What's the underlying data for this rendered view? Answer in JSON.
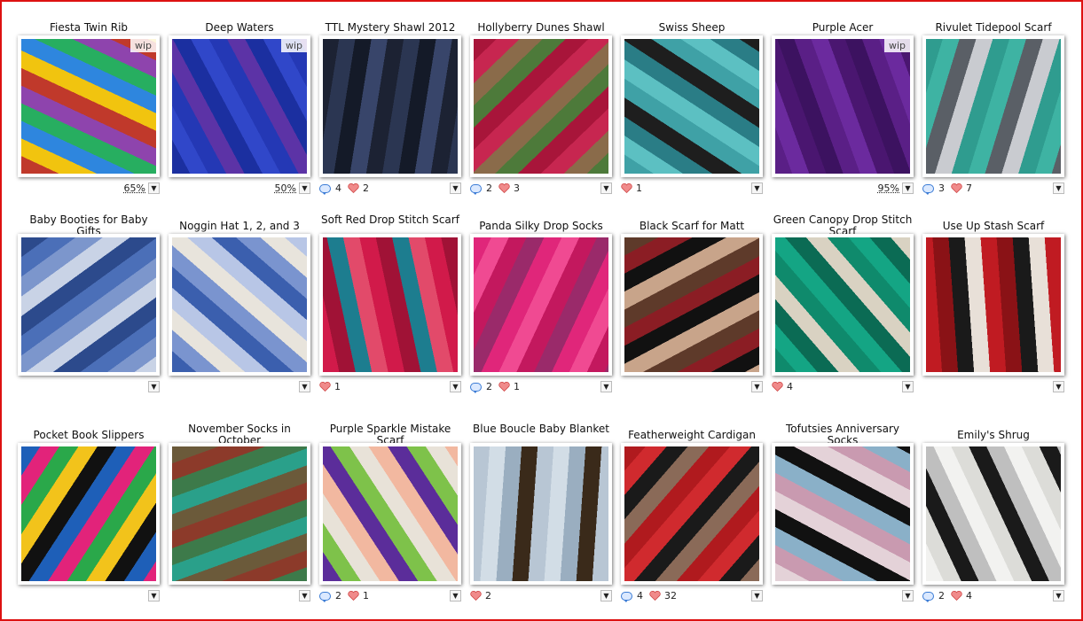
{
  "projects": [
    {
      "title": "Fiesta Twin Rib",
      "wip": "wip",
      "progress": "65%",
      "comments": "",
      "favorites": "",
      "colors": [
        "#c0392b",
        "#f1c40f",
        "#2e86de",
        "#27ae60",
        "#8e44ad"
      ]
    },
    {
      "title": "Deep Waters",
      "wip": "wip",
      "progress": "50%",
      "comments": "",
      "favorites": "",
      "colors": [
        "#1b2fa0",
        "#3047c9",
        "#2438b5",
        "#5c33a6"
      ]
    },
    {
      "title": "TTL Mystery Shawl 2012",
      "wip": "",
      "progress": "",
      "comments": "4",
      "favorites": "2",
      "colors": [
        "#1c2233",
        "#2b3652",
        "#141a28",
        "#38456a"
      ]
    },
    {
      "title": "Hollyberry Dunes Shawl",
      "wip": "",
      "progress": "",
      "comments": "2",
      "favorites": "3",
      "colors": [
        "#a8153a",
        "#c72650",
        "#8a6b4a",
        "#4d7a3a"
      ]
    },
    {
      "title": "Swiss Sheep",
      "wip": "",
      "progress": "",
      "comments": "",
      "favorites": "1",
      "colors": [
        "#3fa1a6",
        "#5cc0c2",
        "#2a7d86",
        "#1e1e1e"
      ]
    },
    {
      "title": "Purple Acer",
      "wip": "wip",
      "progress": "95%",
      "comments": "",
      "favorites": "",
      "colors": [
        "#5a1f86",
        "#6b2a9e",
        "#4a1670",
        "#3c1260"
      ]
    },
    {
      "title": "Rivulet Tidepool Scarf",
      "wip": "",
      "progress": "",
      "comments": "3",
      "favorites": "7",
      "colors": [
        "#2f9c8f",
        "#3eb3a3",
        "#5a5f66",
        "#c9cbd0"
      ]
    },
    {
      "title": "Baby Booties for Baby Gifts",
      "wip": "",
      "progress": "",
      "comments": "",
      "favorites": "",
      "colors": [
        "#2c4a8c",
        "#4b6fb8",
        "#7c96cc",
        "#c9d3e6"
      ]
    },
    {
      "title": "Noggin Hat 1, 2, and 3",
      "wip": "",
      "progress": "",
      "comments": "",
      "favorites": "",
      "colors": [
        "#3b5fae",
        "#7a94cf",
        "#e8e4dc",
        "#b8c6e6"
      ]
    },
    {
      "title": "Soft Red Drop Stitch Scarf",
      "wip": "",
      "progress": "",
      "comments": "",
      "favorites": "1",
      "colors": [
        "#d11a4a",
        "#a01236",
        "#1d7d8f",
        "#e24a6a"
      ]
    },
    {
      "title": "Panda Silky Drop Socks",
      "wip": "",
      "progress": "",
      "comments": "2",
      "favorites": "1",
      "colors": [
        "#e0267a",
        "#f04a92",
        "#c3185e",
        "#9a2a6a"
      ]
    },
    {
      "title": "Black Scarf for Matt",
      "wip": "",
      "progress": "",
      "comments": "",
      "favorites": "",
      "colors": [
        "#5e3a2a",
        "#8b1d24",
        "#111111",
        "#c8a48a"
      ]
    },
    {
      "title": "Green Canopy Drop Stitch Scarf",
      "wip": "",
      "progress": "",
      "comments": "",
      "favorites": "4",
      "colors": [
        "#0f8a6c",
        "#14a584",
        "#0b6b54",
        "#d9d2c2"
      ]
    },
    {
      "title": "Use Up Stash Scarf",
      "wip": "",
      "progress": "",
      "comments": "",
      "favorites": "",
      "colors": [
        "#c01b22",
        "#8a1216",
        "#1a1a1a",
        "#e8e0d8"
      ]
    },
    {
      "title": "Pocket Book Slippers",
      "wip": "",
      "progress": "",
      "comments": "",
      "favorites": "",
      "colors": [
        "#1e5fb8",
        "#e2237a",
        "#2aa84a",
        "#f2c31b",
        "#111111"
      ]
    },
    {
      "title": "November Socks in October",
      "wip": "",
      "progress": "",
      "comments": "",
      "favorites": "",
      "colors": [
        "#6b5a3a",
        "#8c3a2a",
        "#3d7a4a",
        "#2aa08a"
      ]
    },
    {
      "title": "Purple Sparkle Mistake Scarf",
      "wip": "",
      "progress": "",
      "comments": "2",
      "favorites": "1",
      "colors": [
        "#5b2d9a",
        "#7ec24a",
        "#e8e2d8",
        "#f2b8a0"
      ]
    },
    {
      "title": "Blue Boucle Baby Blanket",
      "wip": "",
      "progress": "",
      "comments": "",
      "favorites": "2",
      "colors": [
        "#b8c6d4",
        "#d2dde6",
        "#9aaec0",
        "#3a2a1a"
      ]
    },
    {
      "title": "Featherweight Cardigan",
      "wip": "",
      "progress": "",
      "comments": "4",
      "favorites": "32",
      "colors": [
        "#b01a1e",
        "#d02a2e",
        "#1a1a1a",
        "#8a6a58"
      ]
    },
    {
      "title": "Tofutsies Anniversary Socks",
      "wip": "",
      "progress": "",
      "comments": "",
      "favorites": "",
      "colors": [
        "#e4d2d8",
        "#c99ab0",
        "#8ab0c8",
        "#111111"
      ]
    },
    {
      "title": "Emily's Shrug",
      "wip": "",
      "progress": "",
      "comments": "2",
      "favorites": "4",
      "colors": [
        "#f2f2f0",
        "#dcdcd8",
        "#1a1a1a",
        "#bfbfbf"
      ]
    }
  ],
  "dropdown_label": "▼"
}
